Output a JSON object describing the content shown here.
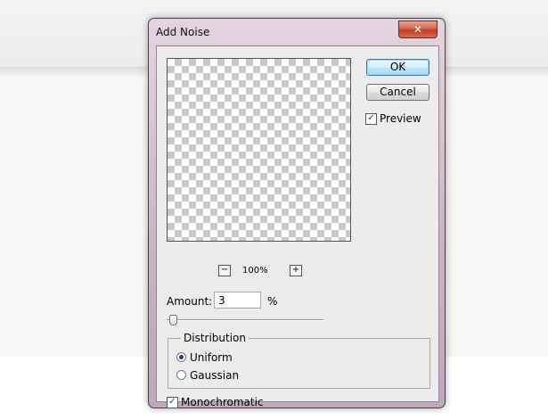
{
  "window": {
    "title": "Add Noise",
    "close_glyph": "✕"
  },
  "preview": {
    "zoom_out": "−",
    "zoom_in": "+",
    "zoom_level": "100%"
  },
  "buttons": {
    "ok": "OK",
    "cancel": "Cancel"
  },
  "preview_checkbox": {
    "label": "Preview",
    "checked": true,
    "mark": "✓"
  },
  "amount": {
    "label": "Amount:",
    "value": "3",
    "unit": "%"
  },
  "distribution": {
    "legend": "Distribution",
    "options": [
      {
        "label": "Uniform",
        "selected": true
      },
      {
        "label": "Gaussian",
        "selected": false
      }
    ]
  },
  "monochromatic": {
    "label": "Monochromatic",
    "checked": true,
    "mark": "✓"
  },
  "colors": {
    "ok_border": "#3c7fb1",
    "close_red": "#c23c24"
  }
}
